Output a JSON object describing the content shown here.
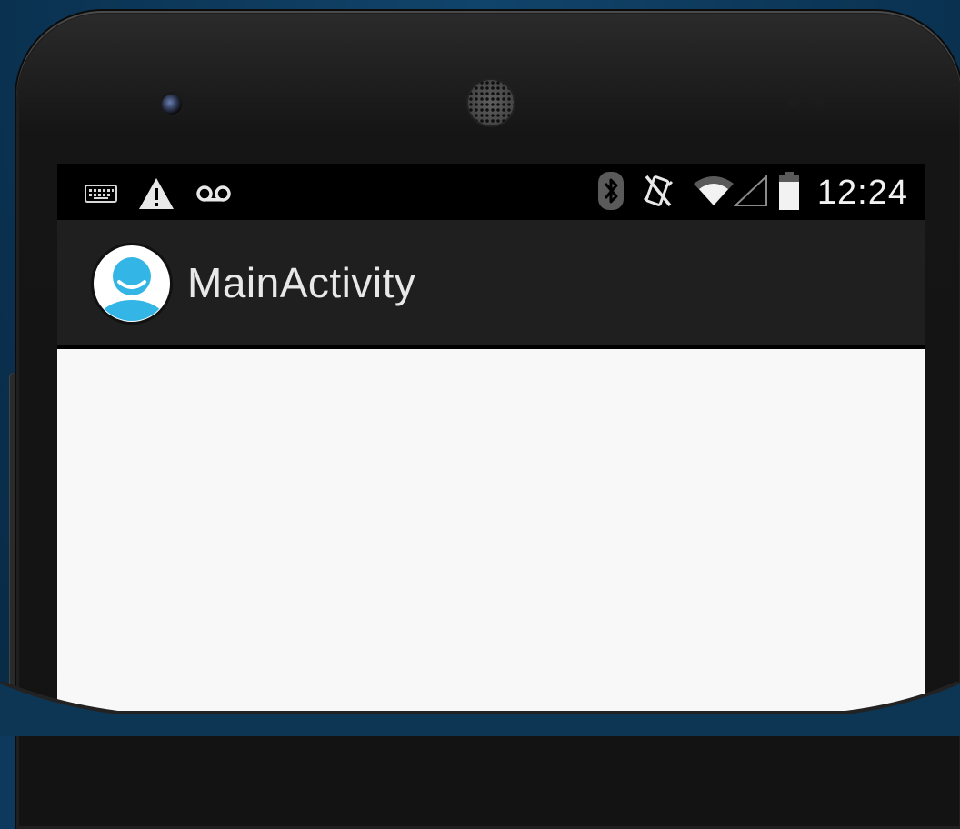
{
  "status_bar": {
    "time": "12:24",
    "left_icons": [
      "keyboard-icon",
      "warning-icon",
      "voicemail-icon"
    ],
    "right_icons": [
      "bluetooth-icon",
      "vibrate-off-icon",
      "wifi-icon",
      "signal-icon",
      "battery-icon"
    ]
  },
  "action_bar": {
    "title": "MainActivity",
    "icon": "user-avatar-icon"
  },
  "colors": {
    "accent": "#33b5e5",
    "action_bar_bg": "#1f1f1f",
    "content_bg": "#f8f8f8"
  }
}
